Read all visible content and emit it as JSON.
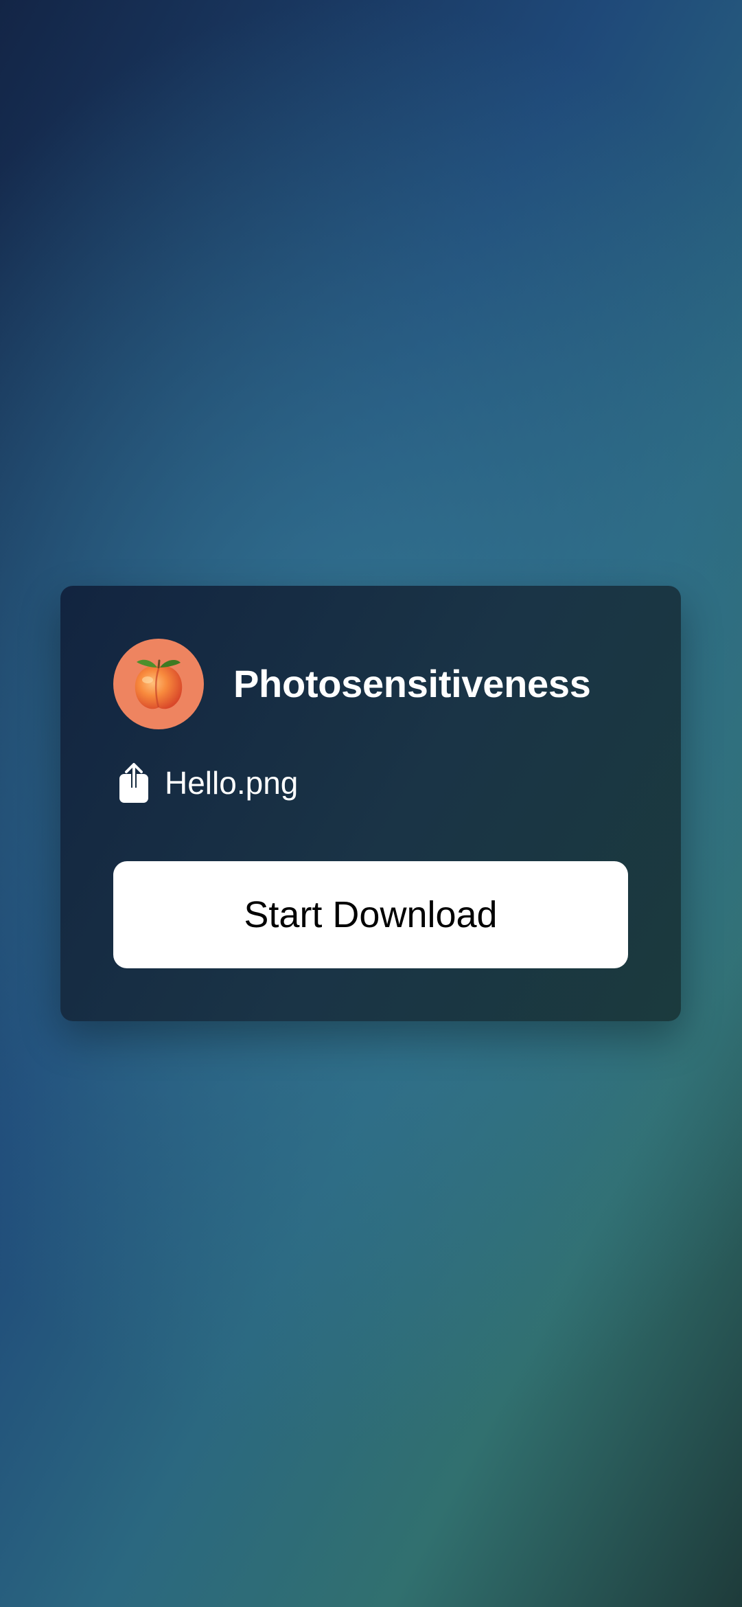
{
  "card": {
    "avatar_icon": "peach-emoji-icon",
    "avatar_color": "#ee8460",
    "title": "Photosensitiveness",
    "file_icon": "share-upload-icon",
    "file_name": "Hello.png",
    "button_label": "Start Download"
  }
}
